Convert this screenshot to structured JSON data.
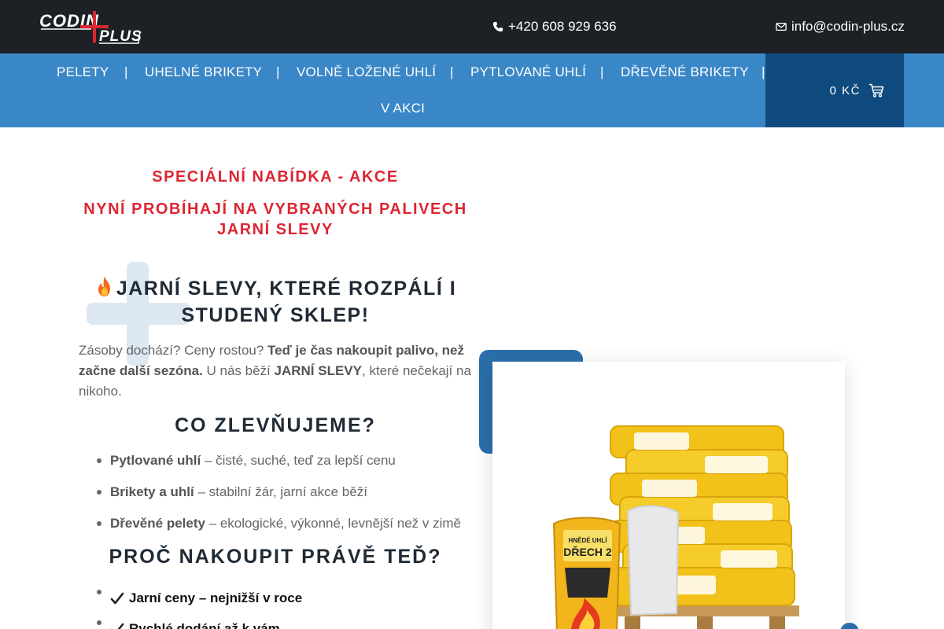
{
  "header": {
    "logo_alt": "CODIN PLUS",
    "phone": "+420 608 929 636",
    "email": "info@codin-plus.cz"
  },
  "nav": {
    "items": [
      "PELETY",
      "UHELNÉ BRIKETY",
      "VOLNĚ LOŽENÉ UHLÍ",
      "PYTLOVANÉ UHLÍ",
      "DŘEVĚNÉ BRIKETY",
      "V AKCI"
    ],
    "separator": "|",
    "cart_total": "0 KČ"
  },
  "promo": {
    "title": "SPECIÁLNÍ NABÍDKA - AKCE",
    "subtitle_line1": "NYNÍ PROBÍHAJÍ NA VYBRANÝCH PALIVECH",
    "subtitle_line2": "JARNÍ SLEVY"
  },
  "article": {
    "heading_line1": "JARNÍ SLEVY, KTERÉ ROZPÁLÍ I",
    "heading_line2": "STUDENÝ SKLEP!",
    "intro_part1": "Zásoby dochází? Ceny rostou? ",
    "intro_bold1": "Teď je čas nakoupit palivo, než začne další sezóna.",
    "intro_part2": " U nás běží ",
    "intro_bold2": "JARNÍ SLEVY",
    "intro_part3": ", které nečekají na nikoho.",
    "section1_title": "CO ZLEVŇUJEME?",
    "section1_items": [
      {
        "bold": "Pytlované uhlí",
        "text": " – čisté, suché, teď za lepší cenu"
      },
      {
        "bold": "Brikety a uhlí",
        "text": " – stabilní žár, jarní akce běží"
      },
      {
        "bold": "Dřevěné pelety",
        "text": " – ekologické, výkonné, levnější než v zimě"
      }
    ],
    "section2_title": "PROČ NAKOUPIT PRÁVĚ TEĎ?",
    "section2_items": [
      "Jarní ceny – nejnižší v roce",
      "Rychlé dodání až k vám"
    ]
  },
  "image": {
    "bag_label": "HNĚDÉ UHLÍ DŘECH 2"
  },
  "colors": {
    "topbar": "#1d2125",
    "nav": "#3a87c7",
    "cart": "#0e4a7e",
    "accent_red": "#dc2632",
    "heading": "#1f2a35"
  }
}
